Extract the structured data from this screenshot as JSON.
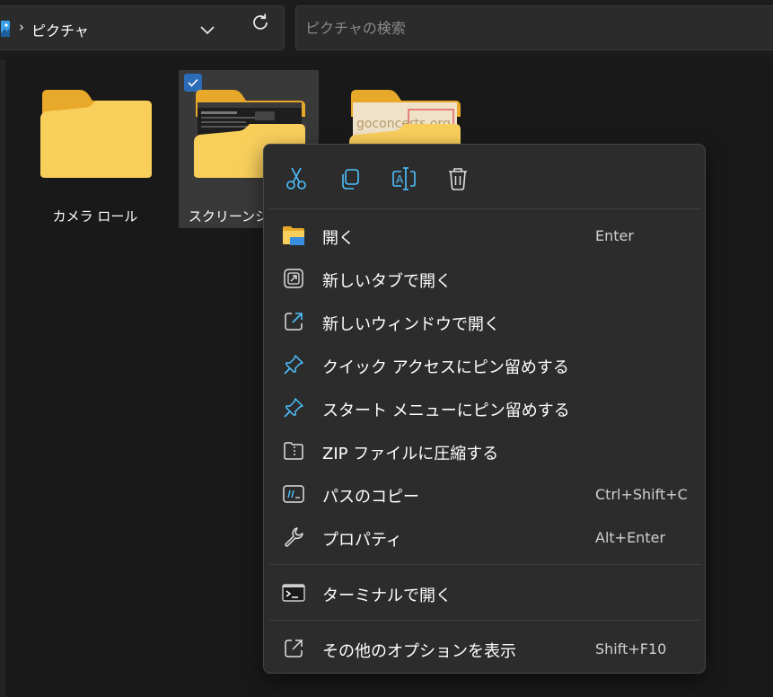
{
  "address_bar": {
    "current_folder": "ピクチャ",
    "separator": "›"
  },
  "search": {
    "placeholder": "ピクチャの検索"
  },
  "items": [
    {
      "label": "カメラ ロール",
      "selected": false
    },
    {
      "label": "スクリーンショット",
      "selected": true
    },
    {
      "label": "",
      "selected": false,
      "thumbnail_text": "goconcerts.org"
    }
  ],
  "context_menu": {
    "quick_actions": [
      "cut-icon",
      "copy-icon",
      "rename-icon",
      "delete-icon"
    ],
    "items": [
      {
        "label": "開く",
        "shortcut": "Enter"
      },
      {
        "label": "新しいタブで開く",
        "shortcut": ""
      },
      {
        "label": "新しいウィンドウで開く",
        "shortcut": ""
      },
      {
        "label": "クイック アクセスにピン留めする",
        "shortcut": ""
      },
      {
        "label": "スタート メニューにピン留めする",
        "shortcut": ""
      },
      {
        "label": "ZIP ファイルに圧縮する",
        "shortcut": ""
      },
      {
        "label": "パスのコピー",
        "shortcut": "Ctrl+Shift+C"
      },
      {
        "label": "プロパティ",
        "shortcut": "Alt+Enter"
      },
      {
        "label": "ターミナルで開く",
        "shortcut": ""
      },
      {
        "label": "その他のオプションを表示",
        "shortcut": "Shift+F10"
      }
    ]
  },
  "colors": {
    "background": "#191919",
    "menu_background": "#2c2c2c",
    "folder_yellow": "#f7c948",
    "accent": "#4cc2ff",
    "checkbox": "#2b6cb8"
  }
}
